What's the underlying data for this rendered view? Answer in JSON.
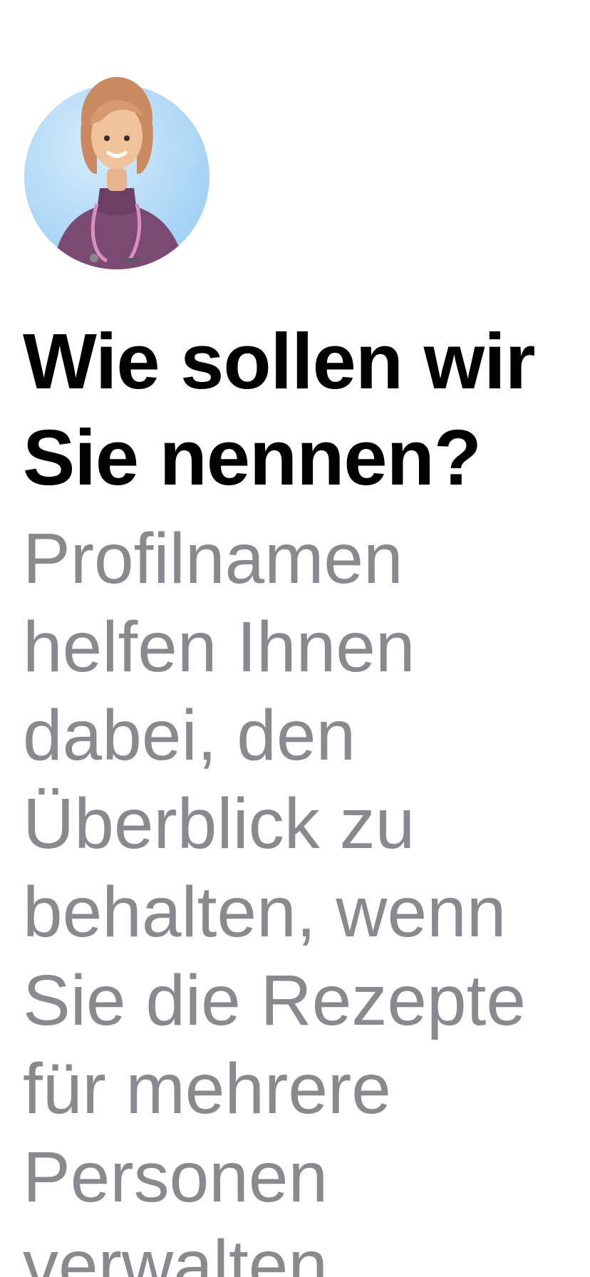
{
  "header": {
    "avatar_icon": "doctor-avatar-icon",
    "title_lines": [
      "Wie sollen wir",
      "Sie nennen?"
    ]
  },
  "body": {
    "description_lines": [
      "Profilnamen",
      "helfen Ihnen",
      "dabei, den",
      "Überblick zu",
      "behalten, wenn",
      "Sie die Rezepte",
      "für mehrere",
      "Personen",
      "verwalten"
    ]
  },
  "colors": {
    "background": "#ffffff",
    "title": "#000000",
    "description": "#8a8a8e",
    "avatar_circle": "#b9def7",
    "avatar_sweater": "#7b4a72"
  }
}
